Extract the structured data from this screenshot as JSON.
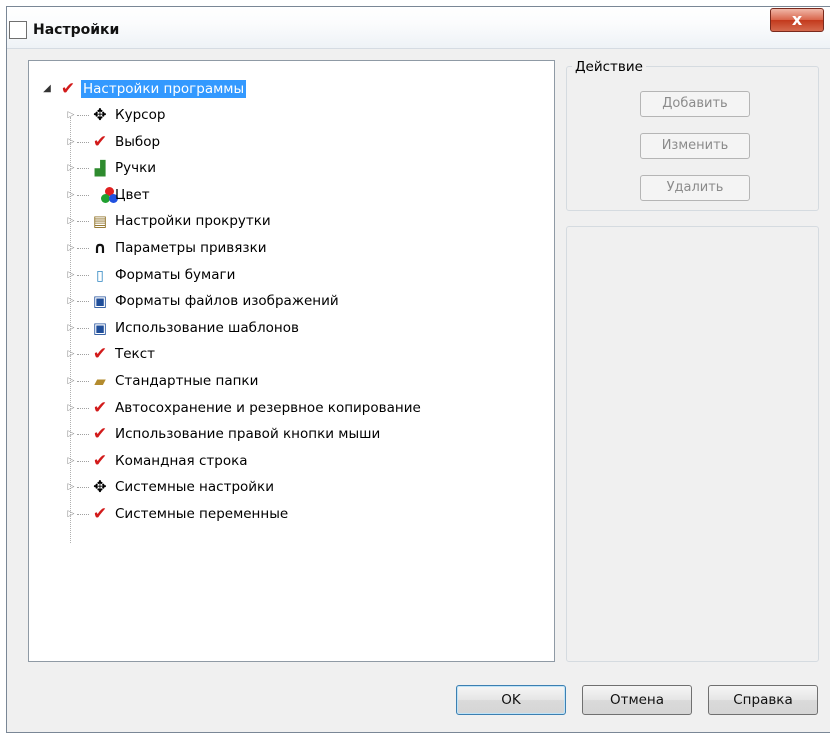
{
  "window": {
    "title": "Настройки",
    "close_label": "x"
  },
  "tree": {
    "root_label": "Настройки программы",
    "items": [
      {
        "label": "Курсор",
        "icon": "cursor-icon"
      },
      {
        "label": "Выбор",
        "icon": "checkmark-icon"
      },
      {
        "label": "Ручки",
        "icon": "grip-icon"
      },
      {
        "label": "Цвет",
        "icon": "color-icon"
      },
      {
        "label": "Настройки прокрутки",
        "icon": "scroll-icon"
      },
      {
        "label": "Параметры привязки",
        "icon": "magnet-icon"
      },
      {
        "label": "Форматы бумаги",
        "icon": "paper-icon"
      },
      {
        "label": "Форматы файлов изображений",
        "icon": "disk-icon"
      },
      {
        "label": "Использование шаблонов",
        "icon": "disk-icon"
      },
      {
        "label": "Текст",
        "icon": "checkmark-icon"
      },
      {
        "label": "Стандартные папки",
        "icon": "folder-icon"
      },
      {
        "label": "Автосохранение и резервное копирование",
        "icon": "checkmark-icon"
      },
      {
        "label": "Использование правой кнопки мыши",
        "icon": "checkmark-icon"
      },
      {
        "label": "Командная строка",
        "icon": "checkmark-icon"
      },
      {
        "label": "Системные настройки",
        "icon": "cursor-icon"
      },
      {
        "label": "Системные переменные",
        "icon": "checkmark-icon"
      }
    ]
  },
  "action_group": {
    "caption": "Действие",
    "add_label": "Добавить",
    "edit_label": "Изменить",
    "delete_label": "Удалить"
  },
  "footer": {
    "ok_label": "OK",
    "cancel_label": "Отмена",
    "help_label": "Справка"
  },
  "colors": {
    "selection": "#3399ff",
    "check": "#d21b1b",
    "close_button": "#c3391c"
  }
}
